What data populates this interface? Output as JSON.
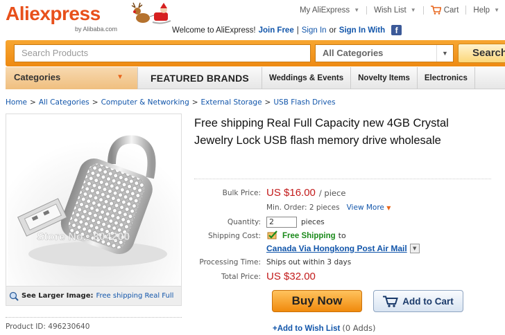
{
  "logo": {
    "brand_left": "Ali",
    "brand_right": "express",
    "byline": "by Alibaba.com"
  },
  "topnav": {
    "my_aliexpress": "My AliExpress",
    "wish_list": "Wish List",
    "cart": "Cart",
    "help": "Help"
  },
  "welcome": {
    "text": "Welcome to AliExpress!",
    "join": "Join Free",
    "sep": "|",
    "sign_in": "Sign In",
    "or": "or",
    "sign_in_with": "Sign In With",
    "fb_letter": "f"
  },
  "search": {
    "placeholder": "Search Products",
    "category": "All Categories",
    "button": "Search"
  },
  "catnav": {
    "categories": "Categories",
    "items": [
      "FEATURED BRANDS",
      "Weddings & Events",
      "Novelty Items",
      "Electronics"
    ]
  },
  "breadcrumb": [
    "Home",
    "All Categories",
    "Computer & Networking",
    "External Storage",
    "USB Flash Drives"
  ],
  "breadcrumb_sep": ">",
  "image": {
    "caption_label": "See Larger Image:",
    "caption_link": "Free shipping Real Full",
    "watermark": "Store No.: 804200"
  },
  "product": {
    "id_label": "Product ID:",
    "id": "496230640",
    "title": "Free shipping Real Full Capacity new 4GB Crystal Jewelry Lock USB flash memory drive wholesale",
    "bulk_price_label": "Bulk Price:",
    "bulk_price": "US $16.00",
    "bulk_unit": "/ piece",
    "min_order": "Min. Order: 2 pieces",
    "view_more": "View More",
    "quantity_label": "Quantity:",
    "quantity": "2",
    "quantity_unit": "pieces",
    "shipping_label": "Shipping Cost:",
    "free_shipping": "Free Shipping",
    "to": "to",
    "ship_method": "Canada Via Hongkong Post Air Mail",
    "processing_label": "Processing Time:",
    "processing": "Ships out within 3 days",
    "total_label": "Total Price:",
    "total": "US $32.00"
  },
  "actions": {
    "buy_now": "Buy Now",
    "add_to_cart": "Add to Cart",
    "add_to_wishlist": "+Add to Wish List",
    "wishlist_count": "(0 Adds)"
  },
  "colors": {
    "brand": "#e8501b",
    "link": "#1155aa",
    "price": "#c21a1a",
    "free": "#1a8a1a"
  },
  "icons": [
    "reindeer-sleigh-icon",
    "cart-icon",
    "facebook-icon",
    "chevron-down-icon",
    "magnifier-icon",
    "free-shipping-icon",
    "cart-add-icon"
  ]
}
